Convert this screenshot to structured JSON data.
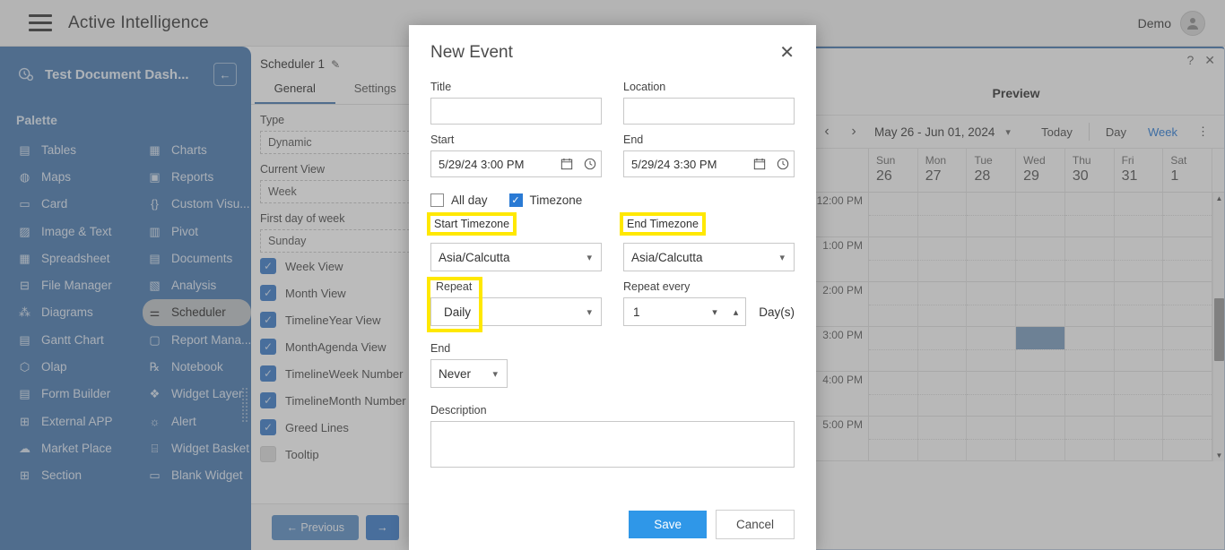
{
  "appbar": {
    "menu_icon": "hamburger-icon",
    "title": "Active Intelligence",
    "user_label": "Demo",
    "avatar_icon": "user-avatar-icon"
  },
  "palette": {
    "doc_icon": "dashboard-icon",
    "dashboard_title": "Test Document Dash...",
    "collapse_icon": "arrow-left-icon",
    "section_label": "Palette",
    "items": [
      {
        "label": "Tables",
        "icon": "table-icon",
        "active": false
      },
      {
        "label": "Charts",
        "icon": "chart-icon",
        "active": false
      },
      {
        "label": "Maps",
        "icon": "map-icon",
        "active": false
      },
      {
        "label": "Reports",
        "icon": "report-icon",
        "active": false
      },
      {
        "label": "Card",
        "icon": "card-icon",
        "active": false
      },
      {
        "label": "Custom Visu...",
        "icon": "braces-icon",
        "active": false
      },
      {
        "label": "Image & Text",
        "icon": "image-icon",
        "active": false
      },
      {
        "label": "Pivot",
        "icon": "pivot-icon",
        "active": false
      },
      {
        "label": "Spreadsheet",
        "icon": "spreadsheet-icon",
        "active": false
      },
      {
        "label": "Documents",
        "icon": "word-doc-icon",
        "active": false
      },
      {
        "label": "File Manager",
        "icon": "folder-tree-icon",
        "active": false
      },
      {
        "label": "Analysis",
        "icon": "analysis-icon",
        "active": false
      },
      {
        "label": "Diagrams",
        "icon": "diagram-icon",
        "active": false
      },
      {
        "label": "Scheduler",
        "icon": "sliders-icon",
        "active": true
      },
      {
        "label": "Gantt Chart",
        "icon": "gantt-icon",
        "active": false
      },
      {
        "label": "Report Mana...",
        "icon": "clipboard-icon",
        "active": false
      },
      {
        "label": "Olap",
        "icon": "olap-icon",
        "active": false
      },
      {
        "label": "Notebook",
        "icon": "notebook-icon",
        "active": false
      },
      {
        "label": "Form Builder",
        "icon": "form-icon",
        "active": false
      },
      {
        "label": "Widget Layer",
        "icon": "layers-icon",
        "active": false
      },
      {
        "label": "External APP",
        "icon": "external-app-icon",
        "active": false
      },
      {
        "label": "Alert",
        "icon": "bell-icon",
        "active": false
      },
      {
        "label": "Market Place",
        "icon": "cloud-up-icon",
        "active": false
      },
      {
        "label": "Widget Basket",
        "icon": "cart-icon",
        "active": false
      },
      {
        "label": "Section",
        "icon": "section-icon",
        "active": false
      },
      {
        "label": "Blank Widget",
        "icon": "blank-widget-icon",
        "active": false
      }
    ]
  },
  "midpanel": {
    "header_title": "Scheduler 1",
    "edit_icon": "pencil-icon",
    "tabs": [
      {
        "label": "General",
        "active": true
      },
      {
        "label": "Settings",
        "active": false
      }
    ],
    "fields": [
      {
        "label": "Type",
        "value": "Dynamic"
      },
      {
        "label": "Current View",
        "value": "Week"
      },
      {
        "label": "First day of week",
        "value": "Sunday"
      }
    ],
    "checkboxes": [
      {
        "label": "Week View",
        "checked": true
      },
      {
        "label": "Month View",
        "checked": true
      },
      {
        "label": "TimelineYear View",
        "checked": true
      },
      {
        "label": "MonthAgenda View",
        "checked": true
      },
      {
        "label": "TimelineWeek Number",
        "checked": true
      },
      {
        "label": "TimelineMonth Number",
        "checked": true
      },
      {
        "label": "Greed Lines",
        "checked": true
      },
      {
        "label": "Tooltip",
        "checked": false
      }
    ],
    "prev_label": "Previous",
    "next_label": "",
    "prev_icon": "arrow-left-icon",
    "next_icon": "arrow-right-icon"
  },
  "preview": {
    "help_icon": "question-mark-icon",
    "close_icon": "close-icon",
    "title": "Preview",
    "toolbar": {
      "prev_icon": "chevron-left-icon",
      "next_icon": "chevron-right-icon",
      "date_range": "May 26 - Jun 01, 2024",
      "dropdown_icon": "chevron-down-icon",
      "today_label": "Today",
      "day_label": "Day",
      "week_label": "Week",
      "active_view": "Week",
      "more_icon": "kebab-menu-icon"
    },
    "calendar": {
      "days": [
        {
          "name": "Sun",
          "num": "26"
        },
        {
          "name": "Mon",
          "num": "27"
        },
        {
          "name": "Tue",
          "num": "28"
        },
        {
          "name": "Wed",
          "num": "29"
        },
        {
          "name": "Thu",
          "num": "30"
        },
        {
          "name": "Fri",
          "num": "31"
        },
        {
          "name": "Sat",
          "num": "1"
        }
      ],
      "times": [
        "12:00 PM",
        "1:00 PM",
        "2:00 PM",
        "3:00 PM",
        "4:00 PM",
        "5:00 PM"
      ],
      "selected_cell": {
        "day_index": 3,
        "time_index": 3
      },
      "scroll_up_icon": "triangle-up-icon",
      "scroll_down_icon": "triangle-down-icon"
    }
  },
  "modal": {
    "title": "New Event",
    "close_icon": "close-icon",
    "title_field": {
      "label": "Title",
      "value": "",
      "placeholder": ""
    },
    "location_field": {
      "label": "Location",
      "value": "",
      "placeholder": ""
    },
    "start_field": {
      "label": "Start",
      "value": "5/29/24 3:00 PM",
      "calendar_icon": "calendar-icon",
      "clock_icon": "clock-icon"
    },
    "end_field": {
      "label": "End",
      "value": "5/29/24 3:30 PM",
      "calendar_icon": "calendar-icon",
      "clock_icon": "clock-icon"
    },
    "all_day": {
      "label": "All day",
      "checked": false
    },
    "timezone": {
      "label": "Timezone",
      "checked": true
    },
    "start_timezone": {
      "label": "Start Timezone",
      "value": "Asia/Calcutta",
      "highlighted": true
    },
    "end_timezone": {
      "label": "End Timezone",
      "value": "Asia/Calcutta",
      "highlighted": true
    },
    "repeat": {
      "label": "Repeat",
      "value": "Daily",
      "highlighted": true
    },
    "repeat_every": {
      "label": "Repeat every",
      "value": "1",
      "unit": "Day(s)"
    },
    "repeat_end": {
      "label": "End",
      "value": "Never"
    },
    "description": {
      "label": "Description",
      "value": ""
    },
    "save_label": "Save",
    "cancel_label": "Cancel",
    "highlight_color": "#ffe800",
    "accent_color": "#2f97e8"
  }
}
